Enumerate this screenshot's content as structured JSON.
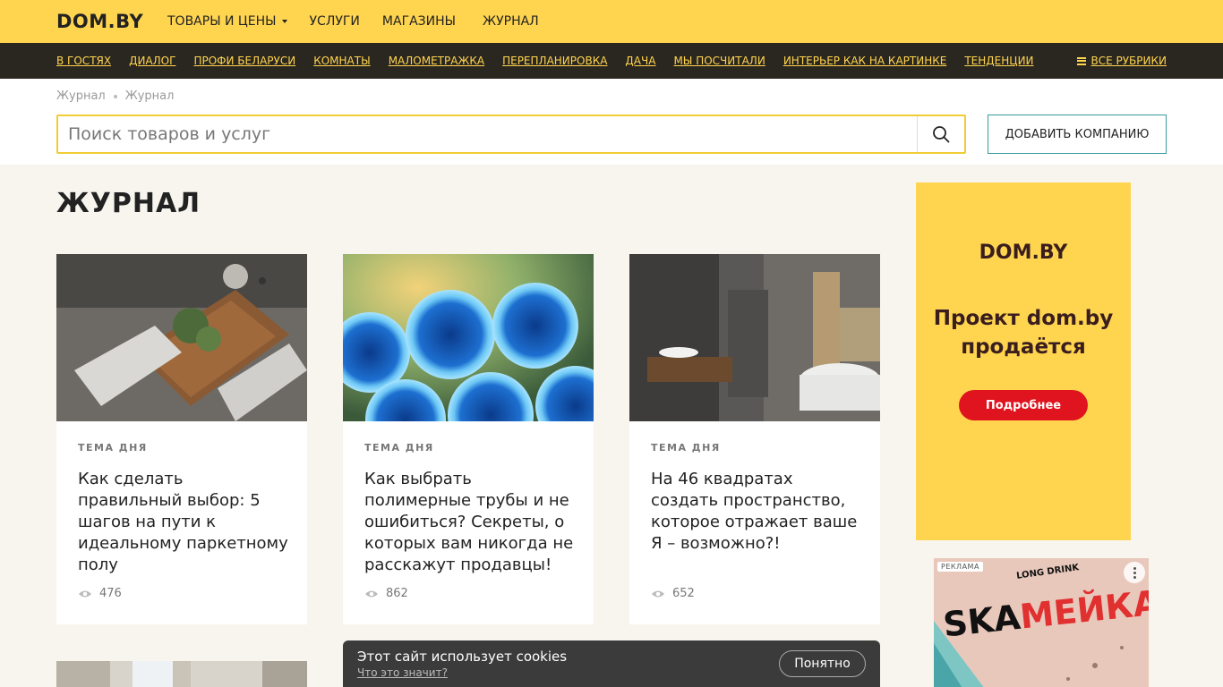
{
  "header": {
    "logo": "DOM.BY",
    "nav": [
      {
        "label": "ТОВАРЫ И ЦЕНЫ"
      },
      {
        "label": "УСЛУГИ"
      },
      {
        "label": "МАГАЗИНЫ"
      },
      {
        "label": "ЖУРНАЛ"
      }
    ]
  },
  "rubrics": {
    "items": [
      "В ГОСТЯХ",
      "ДИАЛОГ",
      "ПРОФИ БЕЛАРУСИ",
      "КОМНАТЫ",
      "МАЛОМЕТРАЖКА",
      "ПЕРЕПЛАНИРОВКА",
      "ДАЧА",
      "МЫ ПОСЧИТАЛИ",
      "ИНТЕРЬЕР КАК НА КАРТИНКЕ",
      "ТЕНДЕНЦИИ"
    ],
    "all_label": "ВСЕ РУБРИКИ"
  },
  "breadcrumb": [
    "Журнал",
    "Журнал"
  ],
  "search": {
    "placeholder": "Поиск товаров и услуг",
    "value": ""
  },
  "add_company_label": "ДОБАВИТЬ КОМПАНИЮ",
  "page_title": "ЖУРНАЛ",
  "articles": [
    {
      "tag": "ТЕМА ДНЯ",
      "title": "Как сделать правильный выбор: 5 шагов на пути к идеальному паркетному полу",
      "views": "476"
    },
    {
      "tag": "ТЕМА ДНЯ",
      "title": "Как выбрать полимерные трубы и не ошибиться? Секреты, о которых вам никогда не расскажут продавцы!",
      "views": "862"
    },
    {
      "tag": "ТЕМА ДНЯ",
      "title": "На 46 квадратах создать пространство, которое отражает ваше Я – возможно?!",
      "views": "652"
    }
  ],
  "ad_banner": {
    "brand": "DOM.BY",
    "headline_line1": "Проект dom.by",
    "headline_line2": "продаётся",
    "button": "Подробнее",
    "color": "#ffd54f",
    "button_color": "#e0141e"
  },
  "ad_skameika": {
    "badge": "РЕКЛАМА",
    "subtitle": "LONG DRINK",
    "logo_part1": "SKA",
    "logo_part2": "МЕЙКА"
  },
  "cookie": {
    "message": "Этот сайт использует cookies",
    "link": "Что это значит?",
    "button": "Понятно"
  },
  "colors": {
    "accent": "#ffd54f",
    "dark_bar": "#2a2620",
    "background": "#f8f5ee",
    "button_border": "#3a9a9a"
  }
}
